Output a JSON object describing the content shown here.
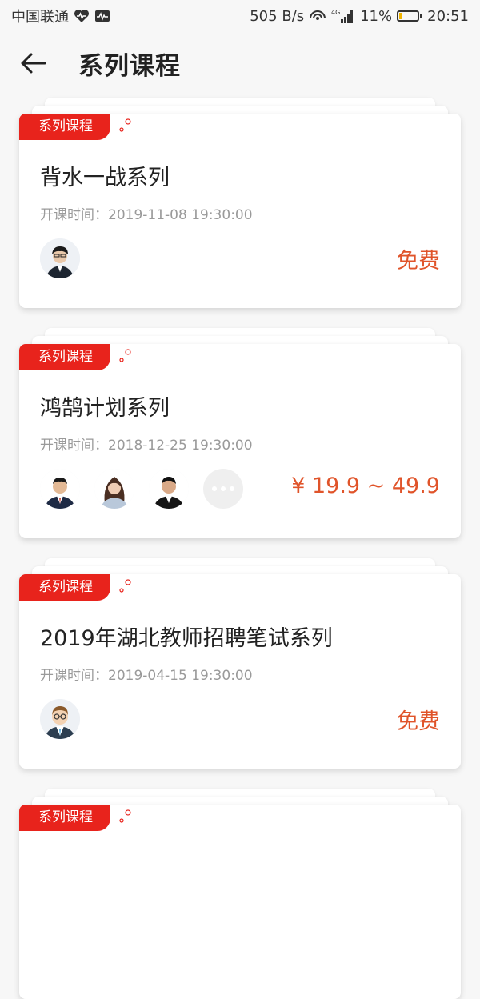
{
  "status_bar": {
    "carrier": "中国联通",
    "speed": "505 B/s",
    "network": "4G",
    "battery": "11%",
    "time": "20:51"
  },
  "header": {
    "back_icon": "arrow-left-icon",
    "title": "系列课程"
  },
  "courses": [
    {
      "tag": "系列课程",
      "title": "背水一战系列",
      "time": "开课时间：2019-11-08 19:30:00",
      "price": "免费",
      "avatar_count": 1,
      "has_more": false
    },
    {
      "tag": "系列课程",
      "title": "鸿鹄计划系列",
      "time": "开课时间：2018-12-25 19:30:00",
      "price": "¥ 19.9 ~ 49.9",
      "avatar_count": 3,
      "has_more": true
    },
    {
      "tag": "系列课程",
      "title": "2019年湖北教师招聘笔试系列",
      "time": "开课时间：2019-04-15 19:30:00",
      "price": "免费",
      "avatar_count": 1,
      "has_more": false
    },
    {
      "tag": "系列课程",
      "title": "",
      "time": "",
      "price": "",
      "avatar_count": 0,
      "has_more": false
    }
  ],
  "colors": {
    "accent": "#e8231c",
    "price": "#e0542a",
    "background": "#f7f7f7"
  }
}
